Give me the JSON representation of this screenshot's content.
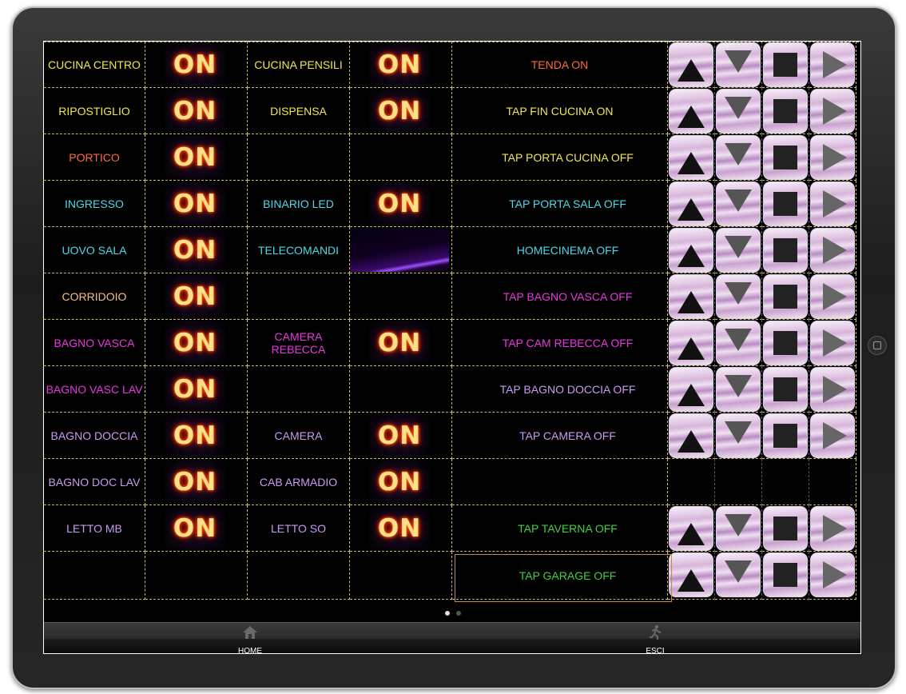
{
  "colors": {
    "yellow": "#f2e84a",
    "orange": "#ff6a3a",
    "cyan": "#4dd8e8",
    "peach": "#f5c080",
    "magenta": "#e838e0",
    "violet": "#c89cf0",
    "green": "#40d040"
  },
  "on_label": "ON",
  "rows": [
    {
      "left": {
        "label": "CUCINA CENTRO",
        "color": "yellow",
        "on": true
      },
      "mid": {
        "label": "CUCINA PENSILI",
        "color": "yellow",
        "on": true
      },
      "scene": {
        "label": "TENDA ON",
        "color": "orange",
        "buttons": true
      }
    },
    {
      "left": {
        "label": "RIPOSTIGLIO",
        "color": "yellow",
        "on": true
      },
      "mid": {
        "label": "DISPENSA",
        "color": "yellow",
        "on": true
      },
      "scene": {
        "label": "TAP FIN CUCINA ON",
        "color": "yellow",
        "buttons": true
      }
    },
    {
      "left": {
        "label": "PORTICO",
        "color": "orange",
        "on": true
      },
      "mid": {
        "label": "",
        "color": "yellow",
        "on": false
      },
      "scene": {
        "label": "TAP PORTA CUCINA OFF",
        "color": "yellow",
        "buttons": true
      }
    },
    {
      "left": {
        "label": "INGRESSO",
        "color": "cyan",
        "on": true
      },
      "mid": {
        "label": "BINARIO LED",
        "color": "cyan",
        "on": true
      },
      "scene": {
        "label": "TAP PORTA SALA OFF",
        "color": "cyan",
        "buttons": true
      }
    },
    {
      "left": {
        "label": "UOVO SALA",
        "color": "cyan",
        "on": true
      },
      "mid": {
        "label": "TELECOMANDI",
        "color": "cyan",
        "on": false,
        "remote": true
      },
      "scene": {
        "label": "HOMECINEMA OFF",
        "color": "cyan",
        "buttons": true
      }
    },
    {
      "left": {
        "label": "CORRIDOIO",
        "color": "peach",
        "on": true
      },
      "mid": {
        "label": "",
        "color": "yellow",
        "on": false
      },
      "scene": {
        "label": "TAP BAGNO VASCA OFF",
        "color": "magenta",
        "buttons": true
      }
    },
    {
      "left": {
        "label": "BAGNO VASCA",
        "color": "magenta",
        "on": true
      },
      "mid": {
        "label": "CAMERA REBECCA",
        "color": "magenta",
        "on": true
      },
      "scene": {
        "label": "TAP CAM REBECCA OFF",
        "color": "magenta",
        "buttons": true
      }
    },
    {
      "left": {
        "label": "BAGNO VASC LAV",
        "color": "magenta",
        "on": true
      },
      "mid": {
        "label": "",
        "color": "yellow",
        "on": false
      },
      "scene": {
        "label": "TAP BAGNO DOCCIA OFF",
        "color": "violet",
        "buttons": true
      }
    },
    {
      "left": {
        "label": "BAGNO DOCCIA",
        "color": "violet",
        "on": true
      },
      "mid": {
        "label": "CAMERA",
        "color": "violet",
        "on": true
      },
      "scene": {
        "label": "TAP CAMERA OFF",
        "color": "violet",
        "buttons": true
      }
    },
    {
      "left": {
        "label": "BAGNO DOC LAV",
        "color": "violet",
        "on": true
      },
      "mid": {
        "label": "CAB ARMADIO",
        "color": "violet",
        "on": true
      },
      "scene": {
        "label": "",
        "color": "violet",
        "buttons": false
      }
    },
    {
      "left": {
        "label": "LETTO MB",
        "color": "violet",
        "on": true
      },
      "mid": {
        "label": "LETTO SO",
        "color": "violet",
        "on": true
      },
      "scene": {
        "label": "TAP TAVERNA OFF",
        "color": "green",
        "buttons": true
      }
    },
    {
      "left": {
        "label": "",
        "color": "yellow",
        "on": false
      },
      "mid": {
        "label": "",
        "color": "yellow",
        "on": false
      },
      "scene": {
        "label": "TAP GARAGE OFF",
        "color": "green",
        "buttons": true
      }
    }
  ],
  "shade_buttons": [
    "up-arrow-icon",
    "down-arrow-icon",
    "stop-icon",
    "play-icon"
  ],
  "pager": {
    "pages": 2,
    "current": 1
  },
  "tabbar": {
    "home_label": "HOME",
    "home_icon": "home-icon",
    "exit_label": "ESCI",
    "exit_icon": "exit-icon"
  }
}
